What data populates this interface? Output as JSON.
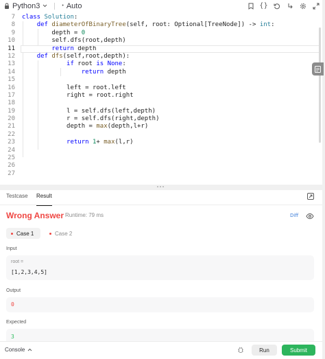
{
  "toolbar": {
    "language": "Python3",
    "mode": "Auto"
  },
  "editor": {
    "lines": [
      {
        "n": "7",
        "html": "<span class=\"kw\">class</span> <span class=\"cls\">Solution</span>:"
      },
      {
        "n": "8",
        "html": "    <span class=\"kw\">def</span> <span class=\"fn\">diameterOfBinaryTree</span>(self, root: Optional[TreeNode]) -> <span class=\"cls\">int</span>:"
      },
      {
        "n": "9",
        "html": "        depth = <span class=\"numlit\">0</span>"
      },
      {
        "n": "10",
        "html": "        self.dfs(root,depth)"
      },
      {
        "n": "11",
        "html": "        <span class=\"kw\">return</span> depth",
        "active": true
      },
      {
        "n": "12",
        "html": "    <span class=\"kw\">def</span> <span class=\"fn\">dfs</span>(self,root,depth):"
      },
      {
        "n": "13",
        "html": "            <span class=\"kw\">if</span> root <span class=\"kw\">is</span> <span class=\"kw\">None</span>:"
      },
      {
        "n": "14",
        "html": "                <span class=\"kw\">return</span> depth"
      },
      {
        "n": "15",
        "html": ""
      },
      {
        "n": "16",
        "html": "            left = root.left"
      },
      {
        "n": "17",
        "html": "            right = root.right"
      },
      {
        "n": "18",
        "html": ""
      },
      {
        "n": "19",
        "html": "            l = self.dfs(left,depth)"
      },
      {
        "n": "20",
        "html": "            r = self.dfs(right,depth)"
      },
      {
        "n": "21",
        "html": "            depth = <span class=\"fn\">max</span>(depth,l+r)"
      },
      {
        "n": "22",
        "html": ""
      },
      {
        "n": "23",
        "html": "            <span class=\"kw\">return</span> <span class=\"numlit\">1</span>+ <span class=\"fn\">max</span>(l,r)"
      },
      {
        "n": "24",
        "html": ""
      },
      {
        "n": "25",
        "html": ""
      },
      {
        "n": "26",
        "html": ""
      },
      {
        "n": "27",
        "html": ""
      }
    ]
  },
  "tabs": {
    "testcase": "Testcase",
    "result": "Result"
  },
  "result": {
    "verdict": "Wrong Answer",
    "runtime": "Runtime: 79 ms",
    "diff": "Diff",
    "case1": "Case 1",
    "case2": "Case 2",
    "input_label": "Input",
    "input_key": "root =",
    "input_value": "[1,2,3,4,5]",
    "output_label": "Output",
    "output_value": "0",
    "expected_label": "Expected",
    "expected_value": "3"
  },
  "footer": {
    "console": "Console",
    "run": "Run",
    "submit": "Submit"
  },
  "colors": {
    "wrong": "#ef4743",
    "submit": "#2db55d",
    "expected": "#2cbb5d"
  }
}
